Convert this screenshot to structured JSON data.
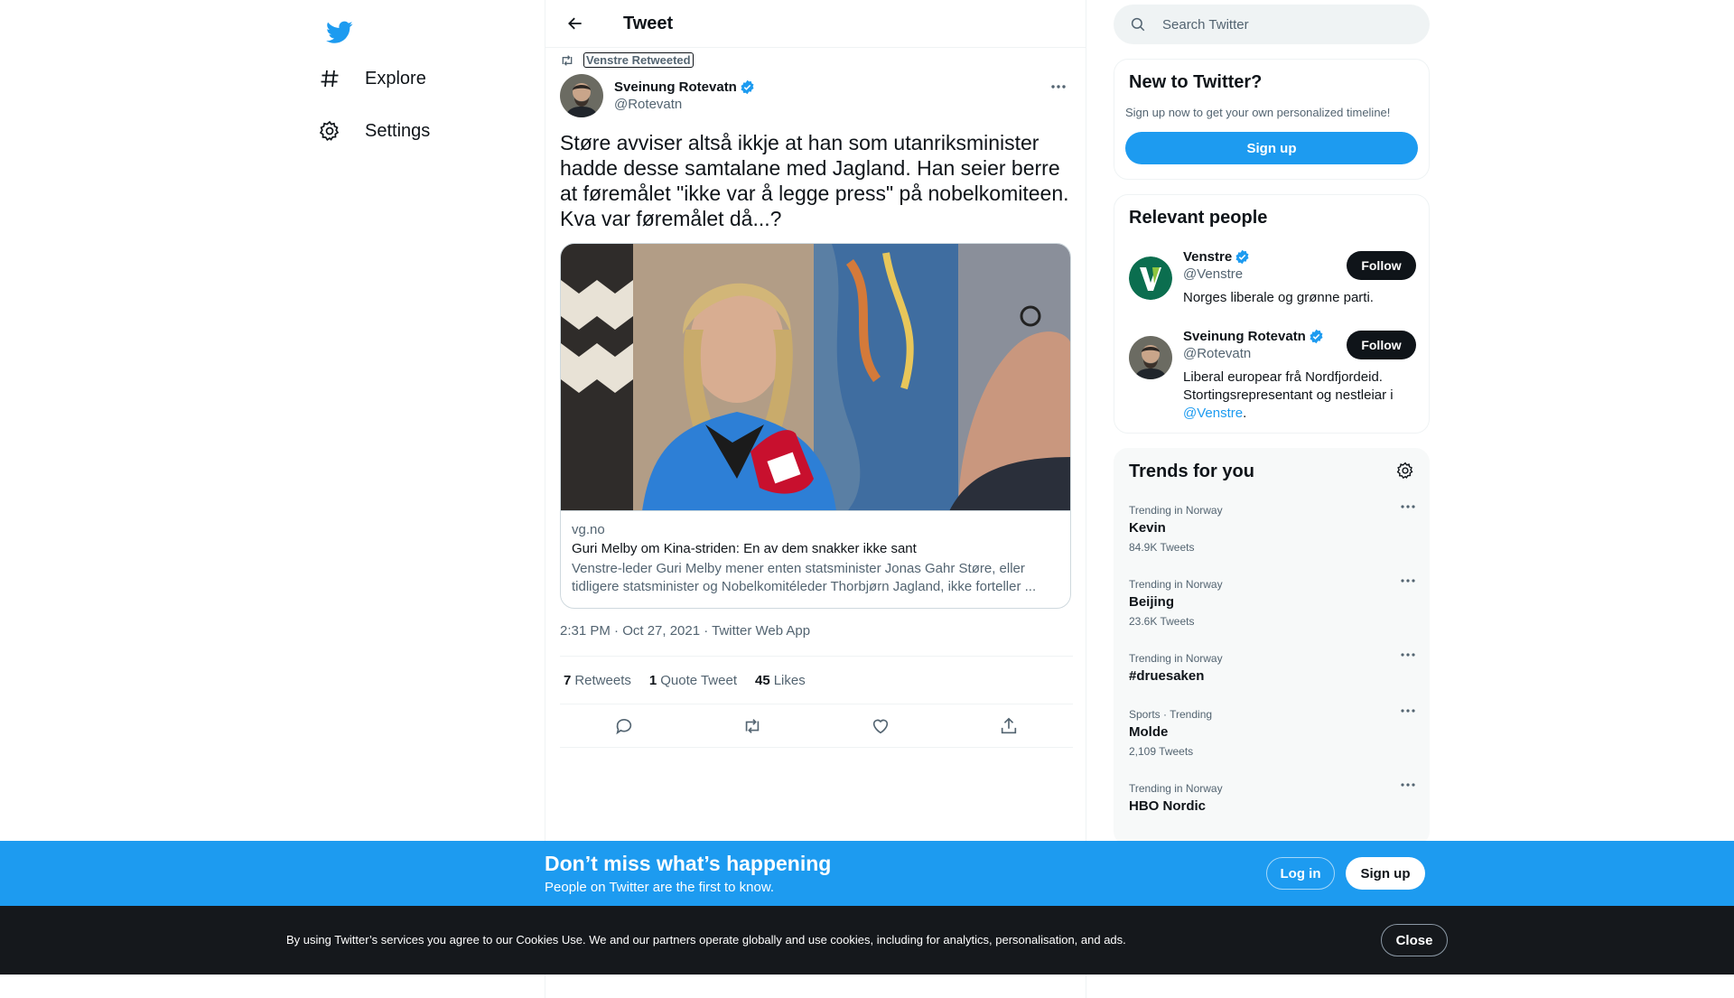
{
  "nav": {
    "items": [
      {
        "label": "Explore",
        "icon": "hashtag-icon"
      },
      {
        "label": "Settings",
        "icon": "gear-icon"
      }
    ]
  },
  "header": {
    "title": "Tweet"
  },
  "tweet": {
    "retweeted_by": "Venstre Retweeted",
    "author_name": "Sveinung Rotevatn",
    "author_handle": "@Rotevatn",
    "text": "Støre avviser altså ikkje at han som utanriksminister hadde desse samtalane med Jagland. Han seier berre at føremålet \"ikke var å legge press\" på nobelkomiteen. Kva var føremålet då...?",
    "card": {
      "domain": "vg.no",
      "title": "Guri Melby om Kina-striden: En av dem snakker ikke sant",
      "description": "Venstre-leder Guri Melby mener enten statsminister Jonas Gahr Støre, eller tidligere statsminister og Nobelkomitéleder Thorbjørn Jagland, ikke forteller ..."
    },
    "timestamp": "2:31 PM · Oct 27, 2021 · Twitter Web App",
    "retweets_count": "7",
    "retweets_label": "Retweets",
    "quotes_count": "1",
    "quotes_label": "Quote Tweet",
    "likes_count": "45",
    "likes_label": "Likes"
  },
  "search": {
    "placeholder": "Search Twitter"
  },
  "new_to_twitter": {
    "title": "New to Twitter?",
    "subtitle": "Sign up now to get your own personalized timeline!",
    "button": "Sign up"
  },
  "relevant_people": {
    "title": "Relevant people",
    "people": [
      {
        "name": "Venstre",
        "handle": "@Venstre",
        "bio": "Norges liberale og grønne parti.",
        "follow": "Follow"
      },
      {
        "name": "Sveinung Rotevatn",
        "handle": "@Rotevatn",
        "bio": "Liberal europear frå Nordfjordeid. Stortingsrepresentant og nestleiar i ",
        "bio_link": "@Venstre",
        "bio_end": ".",
        "follow": "Follow"
      }
    ]
  },
  "trends": {
    "title": "Trends for you",
    "items": [
      {
        "context": "Trending in Norway",
        "name": "Kevin",
        "count": "84.9K Tweets"
      },
      {
        "context": "Trending in Norway",
        "name": "Beijing",
        "count": "23.6K Tweets"
      },
      {
        "context": "Trending in Norway",
        "name": "#druesaken",
        "count": ""
      },
      {
        "context": "Sports · Trending",
        "name": "Molde",
        "count": "2,109 Tweets"
      },
      {
        "context": "Trending in Norway",
        "name": "HBO Nordic",
        "count": ""
      }
    ]
  },
  "banner": {
    "title": "Don’t miss what’s happening",
    "subtitle": "People on Twitter are the first to know.",
    "login": "Log in",
    "signup": "Sign up"
  },
  "cookies": {
    "text": "By using Twitter’s services you agree to our Cookies Use. We and our partners operate globally and use cookies, including for analytics, personalisation, and ads.",
    "close": "Close"
  },
  "colors": {
    "accent": "#1d9bf0",
    "text": "#0f1419",
    "muted": "#536471",
    "banner": "#1d9bf0",
    "cookie_bar": "#15181c"
  }
}
